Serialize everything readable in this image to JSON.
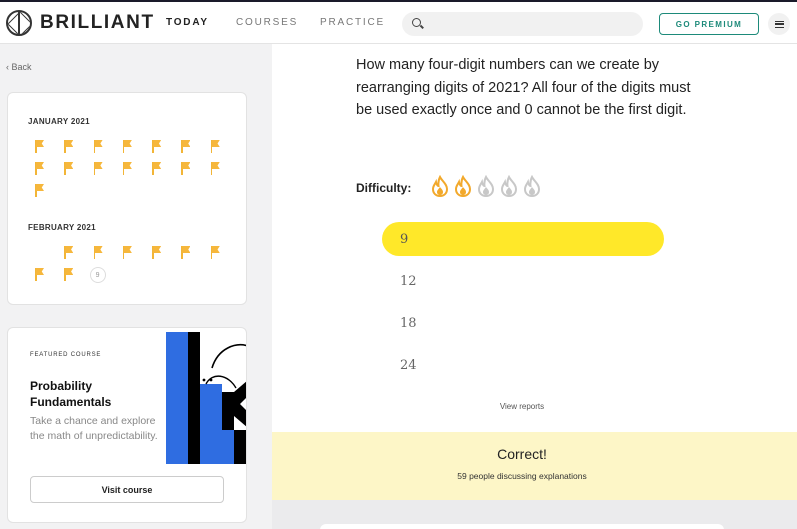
{
  "header": {
    "logo_text": "BRILLIANT",
    "nav": [
      {
        "label": "TODAY",
        "active": true
      },
      {
        "label": "COURSES",
        "active": false
      },
      {
        "label": "PRACTICE",
        "active": false
      }
    ],
    "search_placeholder": "",
    "premium_label": "GO PREMIUM",
    "accent_color": "#1d8a7a"
  },
  "sidebar": {
    "back_label": "Back",
    "calendar": [
      {
        "month": "JANUARY 2021",
        "leading_blanks": 0,
        "days": [
          "flag",
          "flag",
          "flag",
          "flag",
          "flag",
          "flag",
          "flag",
          "flag",
          "flag",
          "flag",
          "flag",
          "flag",
          "flag",
          "flag",
          "flag"
        ]
      },
      {
        "month": "FEBRUARY 2021",
        "leading_blanks": 1,
        "days": [
          "flag",
          "flag",
          "flag",
          "flag",
          "flag",
          "flag",
          "flag",
          "flag",
          "9"
        ]
      }
    ],
    "flag_color": "#f6b73c",
    "featured": {
      "label": "FEATURED COURSE",
      "title": "Probability Fundamentals",
      "description": "Take a chance and explore the math of unpredictability.",
      "button_label": "Visit course"
    }
  },
  "problem": {
    "question": "How many four-digit numbers can we create by rearranging digits of 2021? All four of the digits must be used exactly once and 0 cannot be the first digit.",
    "difficulty_label": "Difficulty:",
    "difficulty_level": 2,
    "difficulty_max": 5,
    "flame_active_color": "#f2a92c",
    "flame_inactive_color": "#c8c8c8",
    "options": [
      {
        "label": "9",
        "selected": true
      },
      {
        "label": "12",
        "selected": false
      },
      {
        "label": "18",
        "selected": false
      },
      {
        "label": "24",
        "selected": false
      }
    ],
    "selected_color": "#ffe829",
    "view_reports": "View reports"
  },
  "feedback": {
    "title": "Correct!",
    "discussing": "59 people discussing explanations"
  }
}
